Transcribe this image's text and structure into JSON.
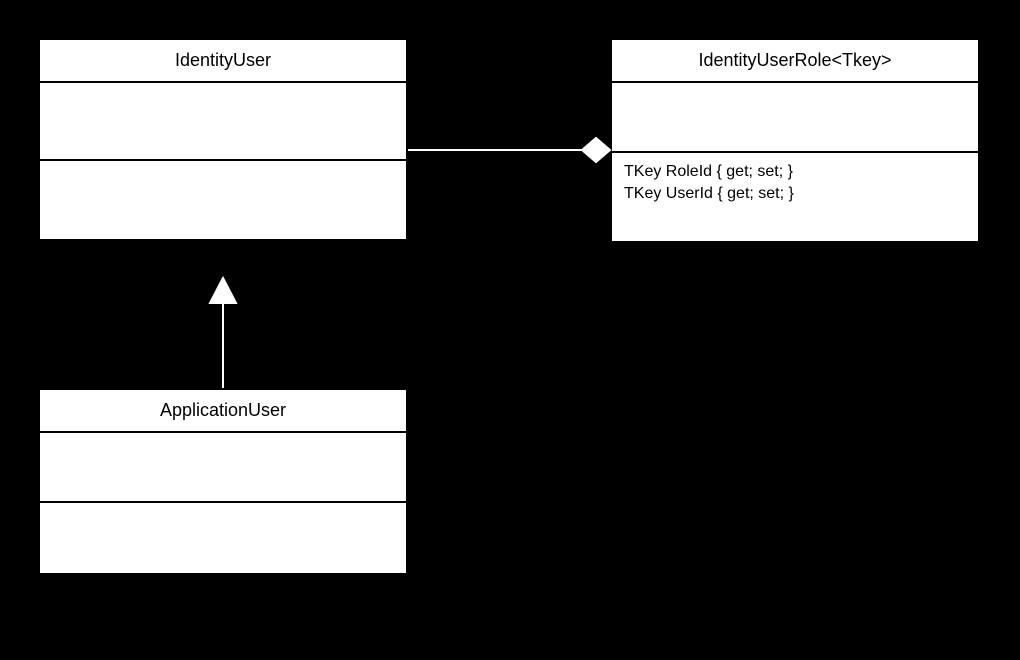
{
  "classes": {
    "identityUser": {
      "name": "IdentityUser",
      "attrs": [],
      "ops": []
    },
    "identityUserRole": {
      "name": "IdentityUserRole<Tkey>",
      "attrs": [],
      "ops": [
        "TKey RoleId { get; set; }",
        "TKey UserId { get; set; }"
      ]
    },
    "applicationUser": {
      "name": "ApplicationUser",
      "attrs": [],
      "ops": []
    }
  },
  "relationships": [
    {
      "type": "inheritance",
      "from": "applicationUser",
      "to": "identityUser"
    },
    {
      "type": "aggregation",
      "from": "identityUser",
      "to": "identityUserRole"
    }
  ]
}
